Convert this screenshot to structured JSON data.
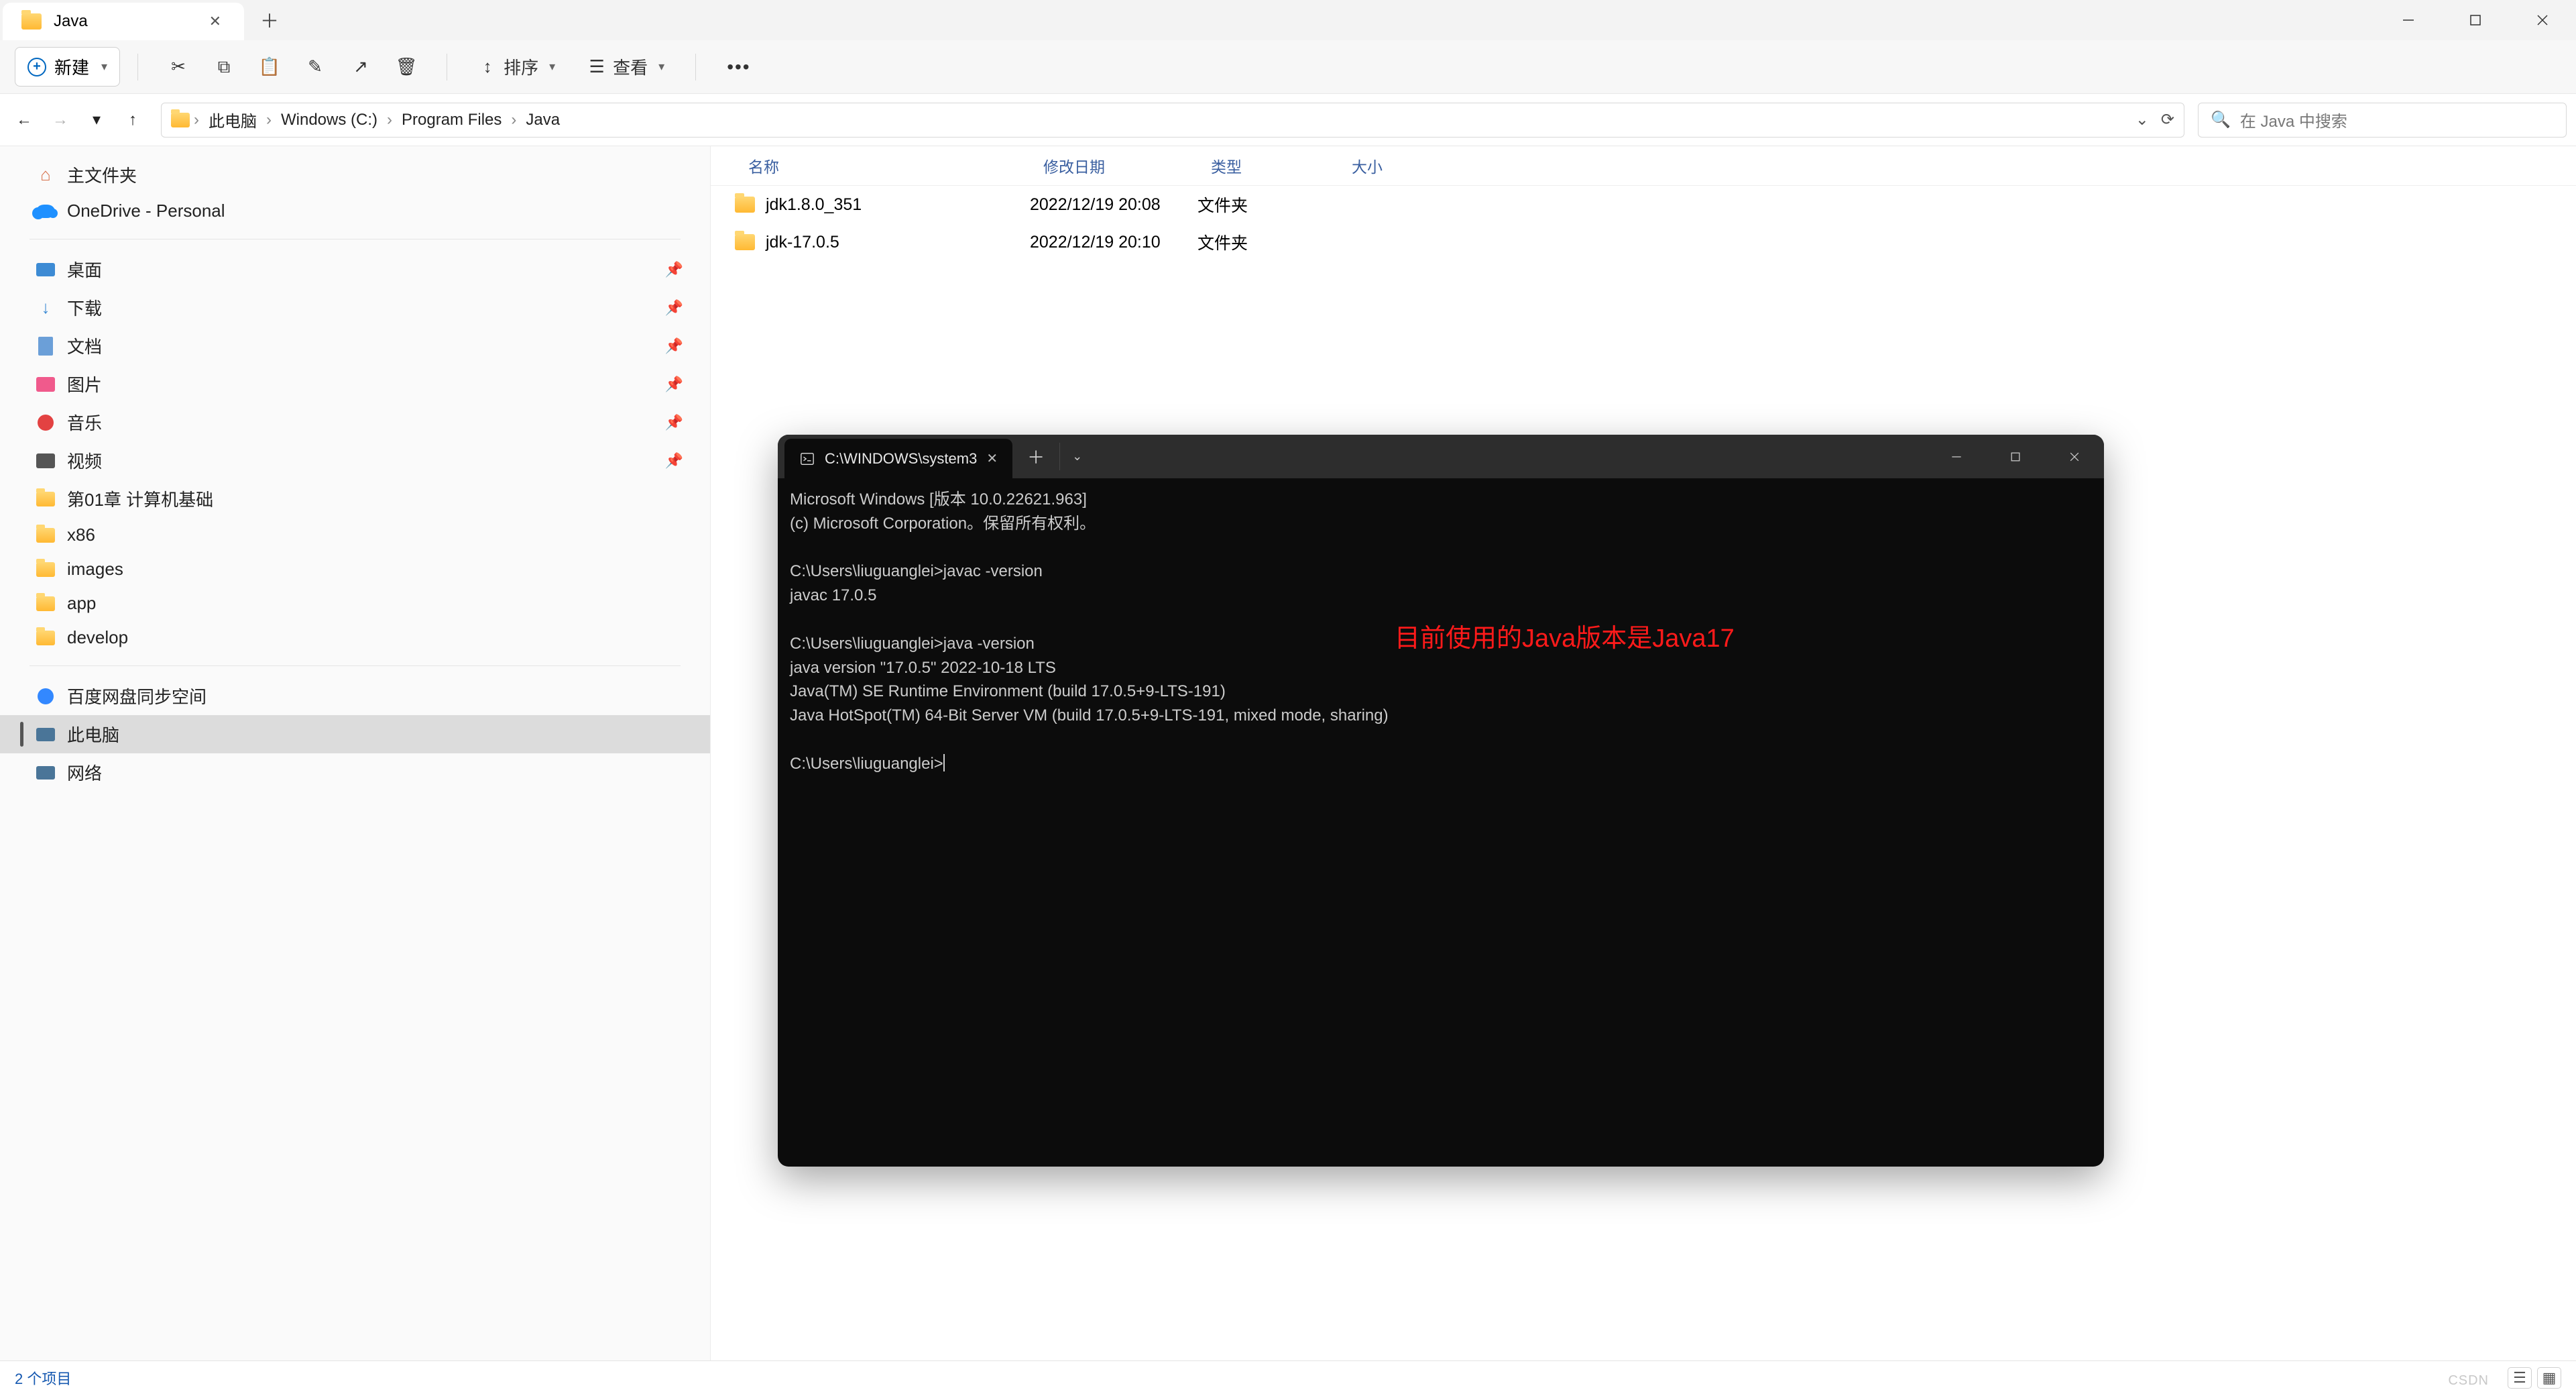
{
  "explorer": {
    "tab_title": "Java",
    "toolbar": {
      "new": "新建",
      "sort": "排序",
      "view": "查看"
    },
    "breadcrumb": {
      "items": [
        "此电脑",
        "Windows (C:)",
        "Program Files",
        "Java"
      ]
    },
    "search": {
      "placeholder": "在 Java 中搜索"
    },
    "sidebar": {
      "home": "主文件夹",
      "onedrive": "OneDrive - Personal",
      "quick": [
        "桌面",
        "下载",
        "文档",
        "图片",
        "音乐",
        "视频",
        "第01章 计算机基础",
        "x86",
        "images",
        "app",
        "develop"
      ],
      "other": [
        "百度网盘同步空间",
        "此电脑",
        "网络"
      ]
    },
    "columns": {
      "name": "名称",
      "date": "修改日期",
      "type": "类型",
      "size": "大小"
    },
    "rows": [
      {
        "name": "jdk1.8.0_351",
        "date": "2022/12/19 20:08",
        "type": "文件夹"
      },
      {
        "name": "jdk-17.0.5",
        "date": "2022/12/19 20:10",
        "type": "文件夹"
      }
    ],
    "status": "2 个项目"
  },
  "terminal": {
    "tab_title": "C:\\WINDOWS\\system3",
    "lines": [
      "Microsoft Windows [版本 10.0.22621.963]",
      "(c) Microsoft Corporation。保留所有权利。",
      "",
      "C:\\Users\\liuguanglei>javac -version",
      "javac 17.0.5",
      "",
      "C:\\Users\\liuguanglei>java -version",
      "java version \"17.0.5\" 2022-10-18 LTS",
      "Java(TM) SE Runtime Environment (build 17.0.5+9-LTS-191)",
      "Java HotSpot(TM) 64-Bit Server VM (build 17.0.5+9-LTS-191, mixed mode, sharing)",
      "",
      "C:\\Users\\liuguanglei>"
    ]
  },
  "annotation": "目前使用的Java版本是Java17",
  "watermark": "CSDN"
}
